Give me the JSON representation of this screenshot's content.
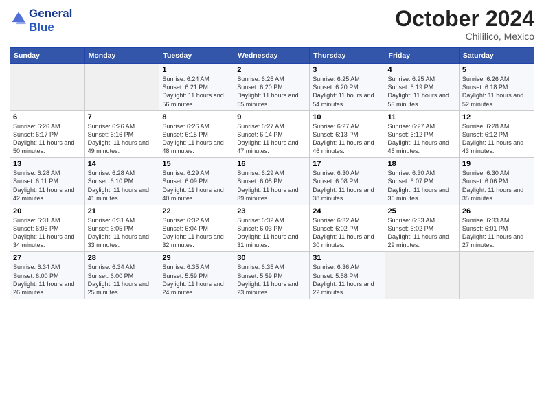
{
  "header": {
    "logo_line1": "General",
    "logo_line2": "Blue",
    "month": "October 2024",
    "location": "Chililico, Mexico"
  },
  "weekdays": [
    "Sunday",
    "Monday",
    "Tuesday",
    "Wednesday",
    "Thursday",
    "Friday",
    "Saturday"
  ],
  "weeks": [
    [
      {
        "day": "",
        "info": ""
      },
      {
        "day": "",
        "info": ""
      },
      {
        "day": "1",
        "info": "Sunrise: 6:24 AM\nSunset: 6:21 PM\nDaylight: 11 hours and 56 minutes."
      },
      {
        "day": "2",
        "info": "Sunrise: 6:25 AM\nSunset: 6:20 PM\nDaylight: 11 hours and 55 minutes."
      },
      {
        "day": "3",
        "info": "Sunrise: 6:25 AM\nSunset: 6:20 PM\nDaylight: 11 hours and 54 minutes."
      },
      {
        "day": "4",
        "info": "Sunrise: 6:25 AM\nSunset: 6:19 PM\nDaylight: 11 hours and 53 minutes."
      },
      {
        "day": "5",
        "info": "Sunrise: 6:26 AM\nSunset: 6:18 PM\nDaylight: 11 hours and 52 minutes."
      }
    ],
    [
      {
        "day": "6",
        "info": "Sunrise: 6:26 AM\nSunset: 6:17 PM\nDaylight: 11 hours and 50 minutes."
      },
      {
        "day": "7",
        "info": "Sunrise: 6:26 AM\nSunset: 6:16 PM\nDaylight: 11 hours and 49 minutes."
      },
      {
        "day": "8",
        "info": "Sunrise: 6:26 AM\nSunset: 6:15 PM\nDaylight: 11 hours and 48 minutes."
      },
      {
        "day": "9",
        "info": "Sunrise: 6:27 AM\nSunset: 6:14 PM\nDaylight: 11 hours and 47 minutes."
      },
      {
        "day": "10",
        "info": "Sunrise: 6:27 AM\nSunset: 6:13 PM\nDaylight: 11 hours and 46 minutes."
      },
      {
        "day": "11",
        "info": "Sunrise: 6:27 AM\nSunset: 6:12 PM\nDaylight: 11 hours and 45 minutes."
      },
      {
        "day": "12",
        "info": "Sunrise: 6:28 AM\nSunset: 6:12 PM\nDaylight: 11 hours and 43 minutes."
      }
    ],
    [
      {
        "day": "13",
        "info": "Sunrise: 6:28 AM\nSunset: 6:11 PM\nDaylight: 11 hours and 42 minutes."
      },
      {
        "day": "14",
        "info": "Sunrise: 6:28 AM\nSunset: 6:10 PM\nDaylight: 11 hours and 41 minutes."
      },
      {
        "day": "15",
        "info": "Sunrise: 6:29 AM\nSunset: 6:09 PM\nDaylight: 11 hours and 40 minutes."
      },
      {
        "day": "16",
        "info": "Sunrise: 6:29 AM\nSunset: 6:08 PM\nDaylight: 11 hours and 39 minutes."
      },
      {
        "day": "17",
        "info": "Sunrise: 6:30 AM\nSunset: 6:08 PM\nDaylight: 11 hours and 38 minutes."
      },
      {
        "day": "18",
        "info": "Sunrise: 6:30 AM\nSunset: 6:07 PM\nDaylight: 11 hours and 36 minutes."
      },
      {
        "day": "19",
        "info": "Sunrise: 6:30 AM\nSunset: 6:06 PM\nDaylight: 11 hours and 35 minutes."
      }
    ],
    [
      {
        "day": "20",
        "info": "Sunrise: 6:31 AM\nSunset: 6:05 PM\nDaylight: 11 hours and 34 minutes."
      },
      {
        "day": "21",
        "info": "Sunrise: 6:31 AM\nSunset: 6:05 PM\nDaylight: 11 hours and 33 minutes."
      },
      {
        "day": "22",
        "info": "Sunrise: 6:32 AM\nSunset: 6:04 PM\nDaylight: 11 hours and 32 minutes."
      },
      {
        "day": "23",
        "info": "Sunrise: 6:32 AM\nSunset: 6:03 PM\nDaylight: 11 hours and 31 minutes."
      },
      {
        "day": "24",
        "info": "Sunrise: 6:32 AM\nSunset: 6:02 PM\nDaylight: 11 hours and 30 minutes."
      },
      {
        "day": "25",
        "info": "Sunrise: 6:33 AM\nSunset: 6:02 PM\nDaylight: 11 hours and 29 minutes."
      },
      {
        "day": "26",
        "info": "Sunrise: 6:33 AM\nSunset: 6:01 PM\nDaylight: 11 hours and 27 minutes."
      }
    ],
    [
      {
        "day": "27",
        "info": "Sunrise: 6:34 AM\nSunset: 6:00 PM\nDaylight: 11 hours and 26 minutes."
      },
      {
        "day": "28",
        "info": "Sunrise: 6:34 AM\nSunset: 6:00 PM\nDaylight: 11 hours and 25 minutes."
      },
      {
        "day": "29",
        "info": "Sunrise: 6:35 AM\nSunset: 5:59 PM\nDaylight: 11 hours and 24 minutes."
      },
      {
        "day": "30",
        "info": "Sunrise: 6:35 AM\nSunset: 5:59 PM\nDaylight: 11 hours and 23 minutes."
      },
      {
        "day": "31",
        "info": "Sunrise: 6:36 AM\nSunset: 5:58 PM\nDaylight: 11 hours and 22 minutes."
      },
      {
        "day": "",
        "info": ""
      },
      {
        "day": "",
        "info": ""
      }
    ]
  ]
}
